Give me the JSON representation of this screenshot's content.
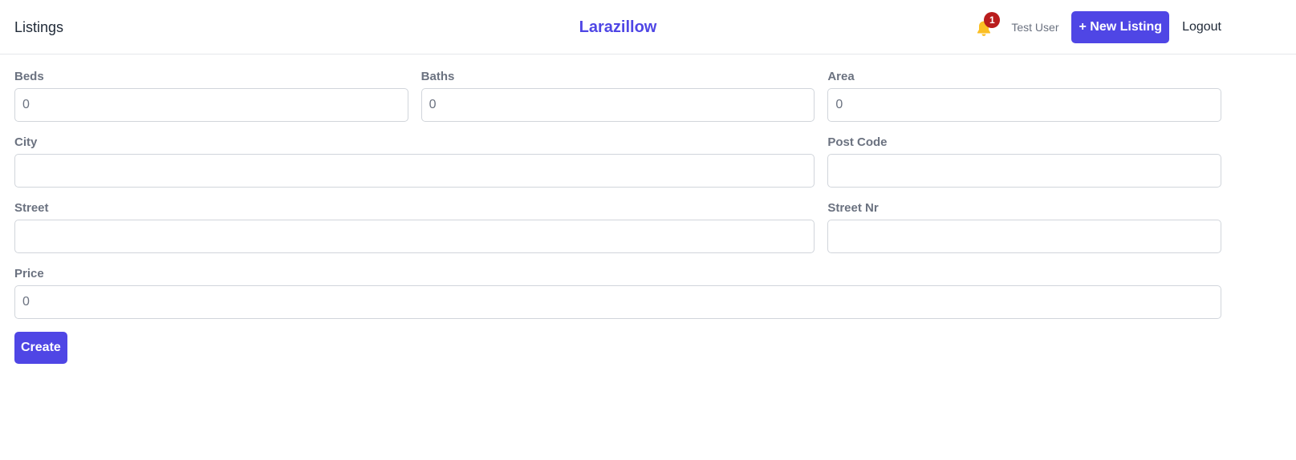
{
  "header": {
    "nav_link": "Listings",
    "brand": "Larazillow",
    "notification_count": "1",
    "user_name": "Test User",
    "new_listing_label": "+ New Listing",
    "logout_label": "Logout"
  },
  "colors": {
    "accent": "#4f46e5",
    "bell": "#fbbf24",
    "badge": "#b91c1c"
  },
  "icons": {
    "bell": "bell-icon"
  },
  "form": {
    "beds": {
      "label": "Beds",
      "value": "0"
    },
    "baths": {
      "label": "Baths",
      "value": "0"
    },
    "area": {
      "label": "Area",
      "value": "0"
    },
    "city": {
      "label": "City",
      "value": ""
    },
    "post_code": {
      "label": "Post Code",
      "value": ""
    },
    "street": {
      "label": "Street",
      "value": ""
    },
    "street_nr": {
      "label": "Street Nr",
      "value": ""
    },
    "price": {
      "label": "Price",
      "value": "0"
    },
    "submit_label": "Create"
  }
}
